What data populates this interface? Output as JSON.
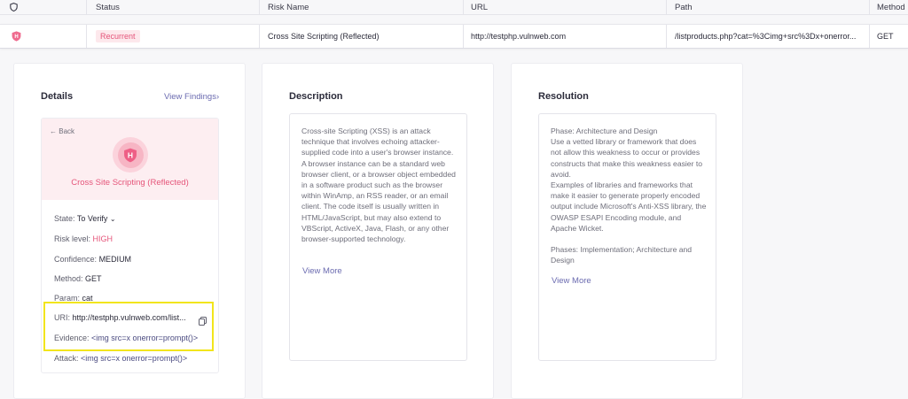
{
  "table": {
    "headers": [
      "Status",
      "Risk Name",
      "URL",
      "Path",
      "Method"
    ],
    "row": {
      "status": "Recurrent",
      "risk_name": "Cross Site Scripting (Reflected)",
      "url": "http://testphp.vulnweb.com",
      "path": "/listproducts.php?cat=%3Cimg+src%3Dx+onerror...",
      "method": "GET"
    }
  },
  "details": {
    "title": "Details",
    "view_findings": "View Findings",
    "back": "Back",
    "risk_name": "Cross Site Scripting (Reflected)",
    "fields": {
      "state_label": "State:",
      "state_value": "To Verify",
      "risk_label": "Risk level:",
      "risk_value": "HIGH",
      "confidence_label": "Confidence:",
      "confidence_value": "MEDIUM",
      "method_label": "Method:",
      "method_value": "GET",
      "param_label": "Param:",
      "param_value": "cat",
      "uri_label": "URI:",
      "uri_value": "http://testphp.vulnweb.com/list...",
      "evidence_label": "Evidence:",
      "evidence_value": "<img src=x onerror=prompt()>",
      "attack_label": "Attack:",
      "attack_value": "<img src=x onerror=prompt()>"
    }
  },
  "description": {
    "title": "Description",
    "text": "Cross-site Scripting (XSS) is an attack technique that involves echoing attacker-supplied code into a user's browser instance. A browser instance can be a standard web browser client, or a browser object embedded in a software product such as the browser within WinAmp, an RSS reader, or an email client. The code itself is usually written in HTML/JavaScript, but may also extend to VBScript, ActiveX, Java, Flash, or any other browser-supported technology.",
    "view_more": "View More"
  },
  "resolution": {
    "title": "Resolution",
    "p1": "Phase: Architecture and Design",
    "p2": "Use a vetted library or framework that does not allow this weakness to occur or provides constructs that make this weakness easier to avoid.",
    "p3": "Examples of libraries and frameworks that make it easier to generate properly encoded output include Microsoft's Anti-XSS library, the OWASP ESAPI Encoding module, and Apache Wicket.",
    "p4": "Phases: Implementation; Architecture and Design",
    "view_more": "View More"
  },
  "colors": {
    "accent": "#6b6bb0",
    "risk_high": "#e5557a",
    "badge_bg": "#fde8ec",
    "highlight": "#f2e51c"
  }
}
